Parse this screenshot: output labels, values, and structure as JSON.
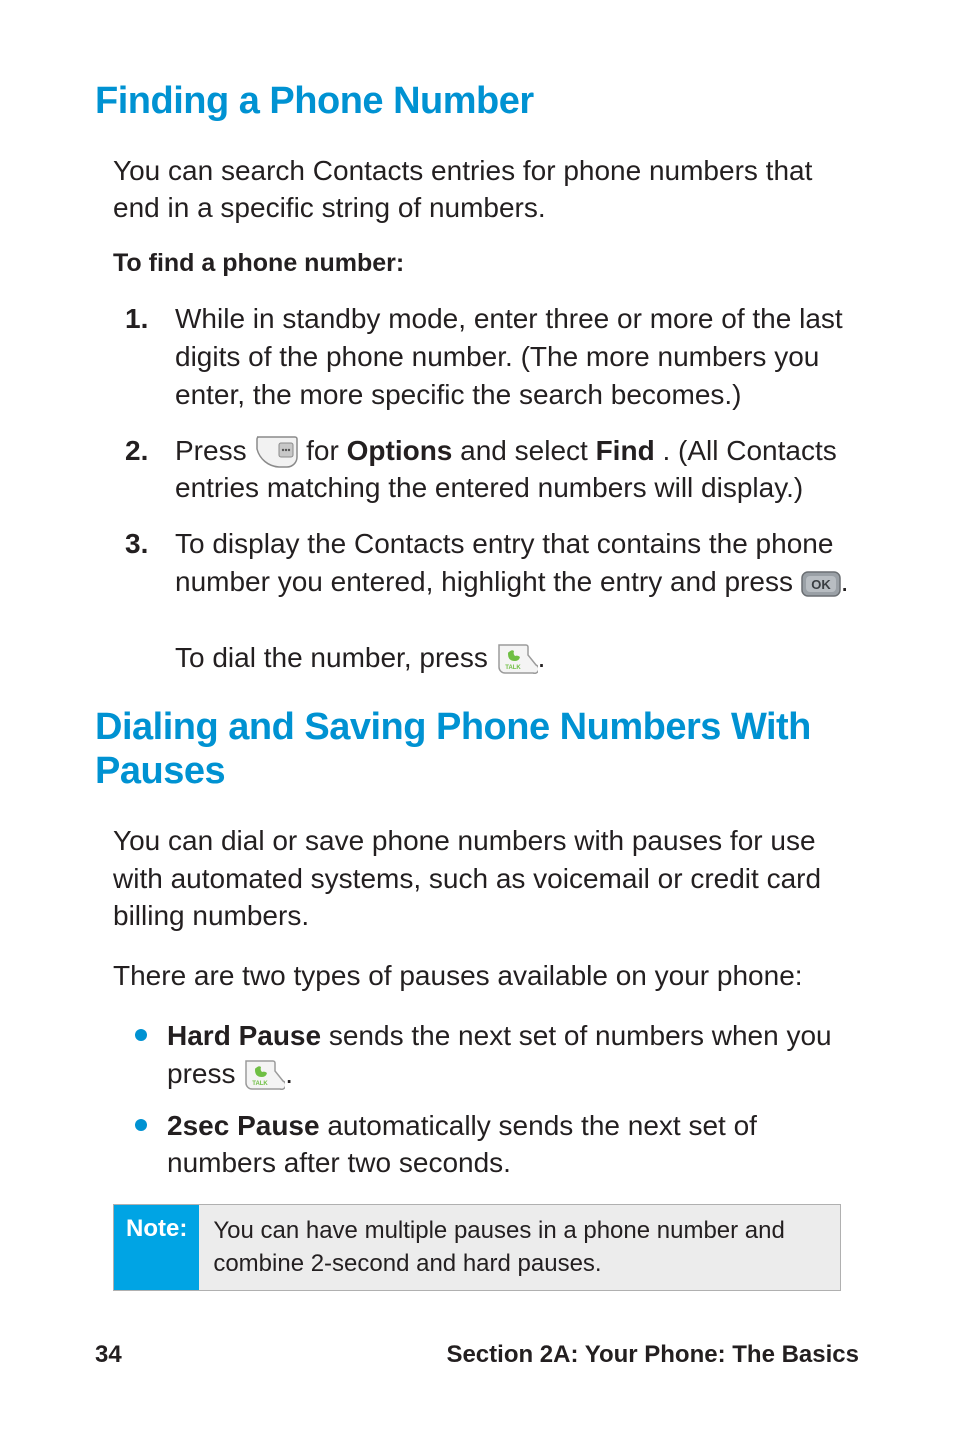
{
  "section1": {
    "heading": "Finding a Phone Number",
    "intro": "You can search Contacts entries for phone numbers that end in a specific string of numbers.",
    "lead": "To find a phone number:",
    "steps": {
      "s1": {
        "n": "1.",
        "text": "While in standby mode, enter three or more of the last digits of the phone number. (The more numbers you enter, the more specific the search becomes.)"
      },
      "s2": {
        "n": "2.",
        "pre": "Press ",
        "mid1": " for ",
        "options": "Options",
        "mid2": " and select ",
        "find": "Find",
        "post": ". (All Contacts entries matching the entered numbers will display.)"
      },
      "s3": {
        "n": "3.",
        "line1a": "To display the Contacts entry that contains the phone number you entered, highlight the entry and press ",
        "line1b": ".",
        "line2a": "To dial the number, press ",
        "line2b": "."
      }
    }
  },
  "section2": {
    "heading": "Dialing and Saving Phone Numbers With Pauses",
    "intro": "You can dial or save phone numbers with pauses for use with automated systems, such as voicemail or credit card billing numbers.",
    "intro2": "There are two types of pauses available on your phone:",
    "bullets": {
      "b1": {
        "strong": "Hard Pause",
        "texta": " sends the next set of numbers when you press ",
        "textb": "."
      },
      "b2": {
        "strong": "2sec Pause",
        "text": " automatically sends the next set of numbers after two seconds."
      }
    },
    "note": {
      "label": "Note:",
      "body": "You can have multiple pauses in a phone number and combine 2-second and hard pauses."
    }
  },
  "footer": {
    "page": "34",
    "section": "Section 2A: Your Phone: The Basics"
  }
}
